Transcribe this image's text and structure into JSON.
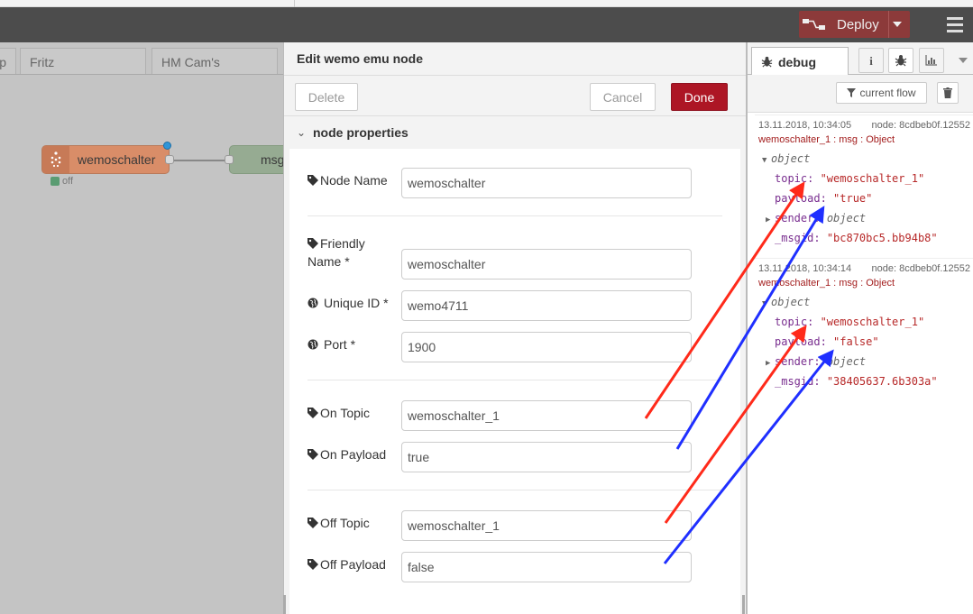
{
  "header": {
    "deploy_label": "Deploy"
  },
  "workspace": {
    "tabs": [
      {
        "label": "rip"
      },
      {
        "label": "Fritz"
      },
      {
        "label": "HM Cam's"
      }
    ],
    "nodes": {
      "wemo_label": "wemoschalter",
      "status_text": "off",
      "msg_label": "msg"
    }
  },
  "tray": {
    "title": "Edit wemo emu node",
    "delete_label": "Delete",
    "cancel_label": "Cancel",
    "done_label": "Done",
    "section_title": "node properties",
    "fields": {
      "node_name": {
        "label": "Node Name",
        "value": "wemoschalter"
      },
      "friendly_name": {
        "label_line1": "Friendly",
        "label_line2": "Name *",
        "value": "wemoschalter"
      },
      "unique_id": {
        "label": "Unique ID *",
        "value": "wemo4711"
      },
      "port": {
        "label": "Port *",
        "value": "1900"
      },
      "on_topic": {
        "label": "On Topic",
        "value": "wemoschalter_1"
      },
      "on_payload": {
        "label": "On Payload",
        "value": "true"
      },
      "off_topic": {
        "label": "Off Topic",
        "value": "wemoschalter_1"
      },
      "off_payload": {
        "label": "Off Payload",
        "value": "false"
      }
    }
  },
  "sidebar": {
    "tab_label": "debug",
    "filter_label": "current flow",
    "messages": [
      {
        "timestamp": "13.11.2018, 10:34:05",
        "node": "node: 8cdbeb0f.12552",
        "name": "wemoschalter_1 : msg : Object",
        "type": "object",
        "topic_key": "topic",
        "topic_val": "\"wemoschalter_1\"",
        "payload_key": "payload",
        "payload_val": "\"true\"",
        "sender_key": "sender",
        "sender_val": "object",
        "msgid_key": "_msgid",
        "msgid_val": "\"bc870bc5.bb94b8\""
      },
      {
        "timestamp": "13.11.2018, 10:34:14",
        "node": "node: 8cdbeb0f.12552",
        "name": "wemoschalter_1 : msg : Object",
        "type": "object",
        "topic_key": "topic",
        "topic_val": "\"wemoschalter_1\"",
        "payload_key": "payload",
        "payload_val": "\"false\"",
        "sender_key": "sender",
        "sender_val": "object",
        "msgid_key": "_msgid",
        "msgid_val": "\"38405637.6b303a\""
      }
    ]
  },
  "colors": {
    "header_bg": "#4c4c4c",
    "deploy_bg": "#8c3a3a",
    "done_bg": "#ad1625",
    "node_wemo": "#d98d68",
    "node_msg": "#96ab92",
    "arrow_red": "#ff2a1a",
    "arrow_blue": "#1f2fff"
  },
  "icons": [
    "deploy-icon",
    "caret-down-icon",
    "menu-icon",
    "tag-icon",
    "globe-icon",
    "bug-icon",
    "info-icon",
    "chart-icon",
    "filter-icon",
    "trash-icon",
    "chevron-down-icon"
  ]
}
